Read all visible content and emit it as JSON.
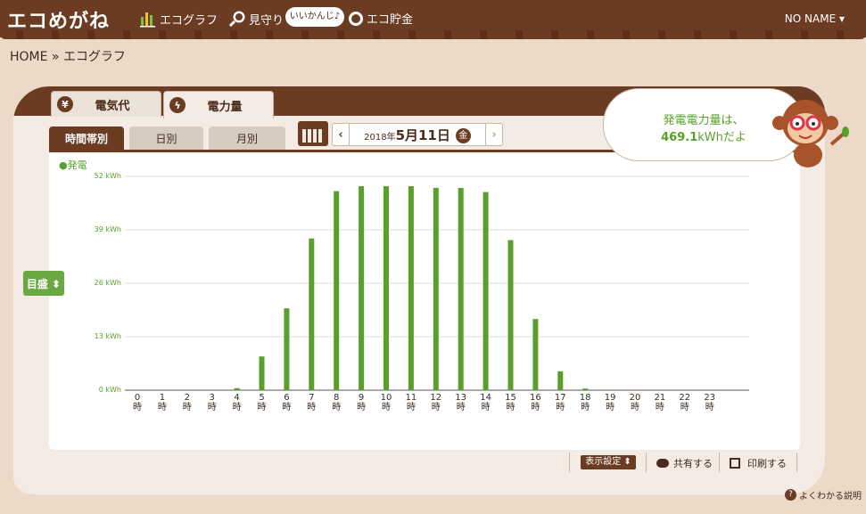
{
  "app": {
    "logo": "エコめがね"
  },
  "nav": {
    "ecograph": "エコグラフ",
    "mimamori": "見守り",
    "mimamori_badge": "いいかんじ♪",
    "savings": "エコ貯金"
  },
  "user": {
    "name": "NO NAME ▾"
  },
  "breadcrumb": "HOME » エコグラフ",
  "tabs": {
    "electricity_cost": "電気代",
    "electricity_amount": "電力量"
  },
  "subtabs": {
    "hourly": "時間帯別",
    "daily": "日別",
    "monthly": "月別"
  },
  "date": {
    "year": "2018年",
    "month_day": "5月11日",
    "weekday": "金",
    "prev": "‹",
    "next": "›"
  },
  "speech": {
    "line1": "発電電力量は、",
    "value": "469.1",
    "unit": "kWhだよ"
  },
  "scale_button": "目盛 ⬍",
  "toolbar": {
    "display_settings": "表示設定 ⬍",
    "share": "共有する",
    "print": "印刷する"
  },
  "help": "よくわかる説明",
  "chart_data": {
    "type": "bar",
    "legend": [
      "発電"
    ],
    "color": "#58a02a",
    "ylim": [
      0,
      52
    ],
    "yticks": [
      "0 kWh",
      "13 kWh",
      "26 kWh",
      "39 kWh",
      "52 kWh"
    ],
    "categories": [
      "0",
      "1",
      "2",
      "3",
      "4",
      "5",
      "6",
      "7",
      "8",
      "9",
      "10",
      "11",
      "12",
      "13",
      "14",
      "15",
      "16",
      "17",
      "18",
      "19",
      "20",
      "21",
      "22",
      "23"
    ],
    "category_suffix": "時",
    "series": [
      {
        "name": "発電",
        "values": [
          0,
          0,
          0,
          0,
          0.5,
          8.2,
          19.9,
          36.9,
          48.4,
          49.6,
          49.6,
          49.6,
          49.2,
          49.2,
          48.2,
          36.5,
          17.3,
          4.6,
          0.4,
          0,
          0,
          0,
          0,
          0
        ]
      }
    ]
  }
}
